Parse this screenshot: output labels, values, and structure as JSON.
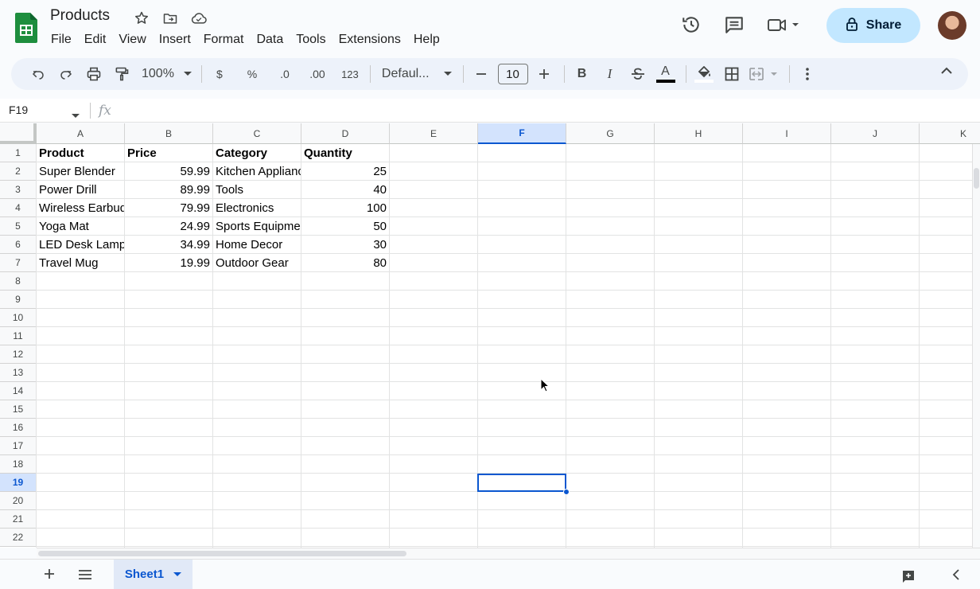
{
  "app": {
    "title": "Products",
    "brand_color": "#1e8e3e",
    "accent_color": "#0b57d0"
  },
  "menus": [
    "File",
    "Edit",
    "View",
    "Insert",
    "Format",
    "Data",
    "Tools",
    "Extensions",
    "Help"
  ],
  "header": {
    "share_label": "Share",
    "icons": [
      "star-icon",
      "move-to-folder-icon",
      "cloud-saved-icon",
      "version-history-icon",
      "comments-icon",
      "meet-icon",
      "lock-icon"
    ]
  },
  "toolbar": {
    "zoom": "100%",
    "currency": "$",
    "percent": "%",
    "decrease_decimals": ".0",
    "increase_decimals": ".00",
    "more_formats": "123",
    "font": "Defaul...",
    "font_size": "10",
    "bold": "B",
    "italic": "I",
    "text_color": "A"
  },
  "formula_bar": {
    "name_box": "F19",
    "fx_label": "fx",
    "value": ""
  },
  "grid": {
    "columns": [
      "A",
      "B",
      "C",
      "D",
      "E",
      "F",
      "G",
      "H",
      "I",
      "J",
      "K"
    ],
    "rows": [
      "1",
      "2",
      "3",
      "4",
      "5",
      "6",
      "7",
      "8",
      "9",
      "10",
      "11",
      "12",
      "13",
      "14",
      "15",
      "16",
      "17",
      "18",
      "19",
      "20",
      "21",
      "22"
    ],
    "selected_column": "F",
    "selected_row": "19",
    "headers": [
      "Product",
      "Price",
      "Category",
      "Quantity"
    ],
    "data": [
      [
        "Super Blender",
        "59.99",
        "Kitchen Applianc",
        "25"
      ],
      [
        "Power Drill",
        "89.99",
        "Tools",
        "40"
      ],
      [
        "Wireless Earbud",
        "79.99",
        "Electronics",
        "100"
      ],
      [
        "Yoga Mat",
        "24.99",
        "Sports Equipmer",
        "50"
      ],
      [
        "LED Desk Lamp",
        "34.99",
        "Home Decor",
        "30"
      ],
      [
        "Travel Mug",
        "19.99",
        "Outdoor Gear",
        "80"
      ]
    ]
  },
  "sheets": {
    "active": "Sheet1"
  }
}
